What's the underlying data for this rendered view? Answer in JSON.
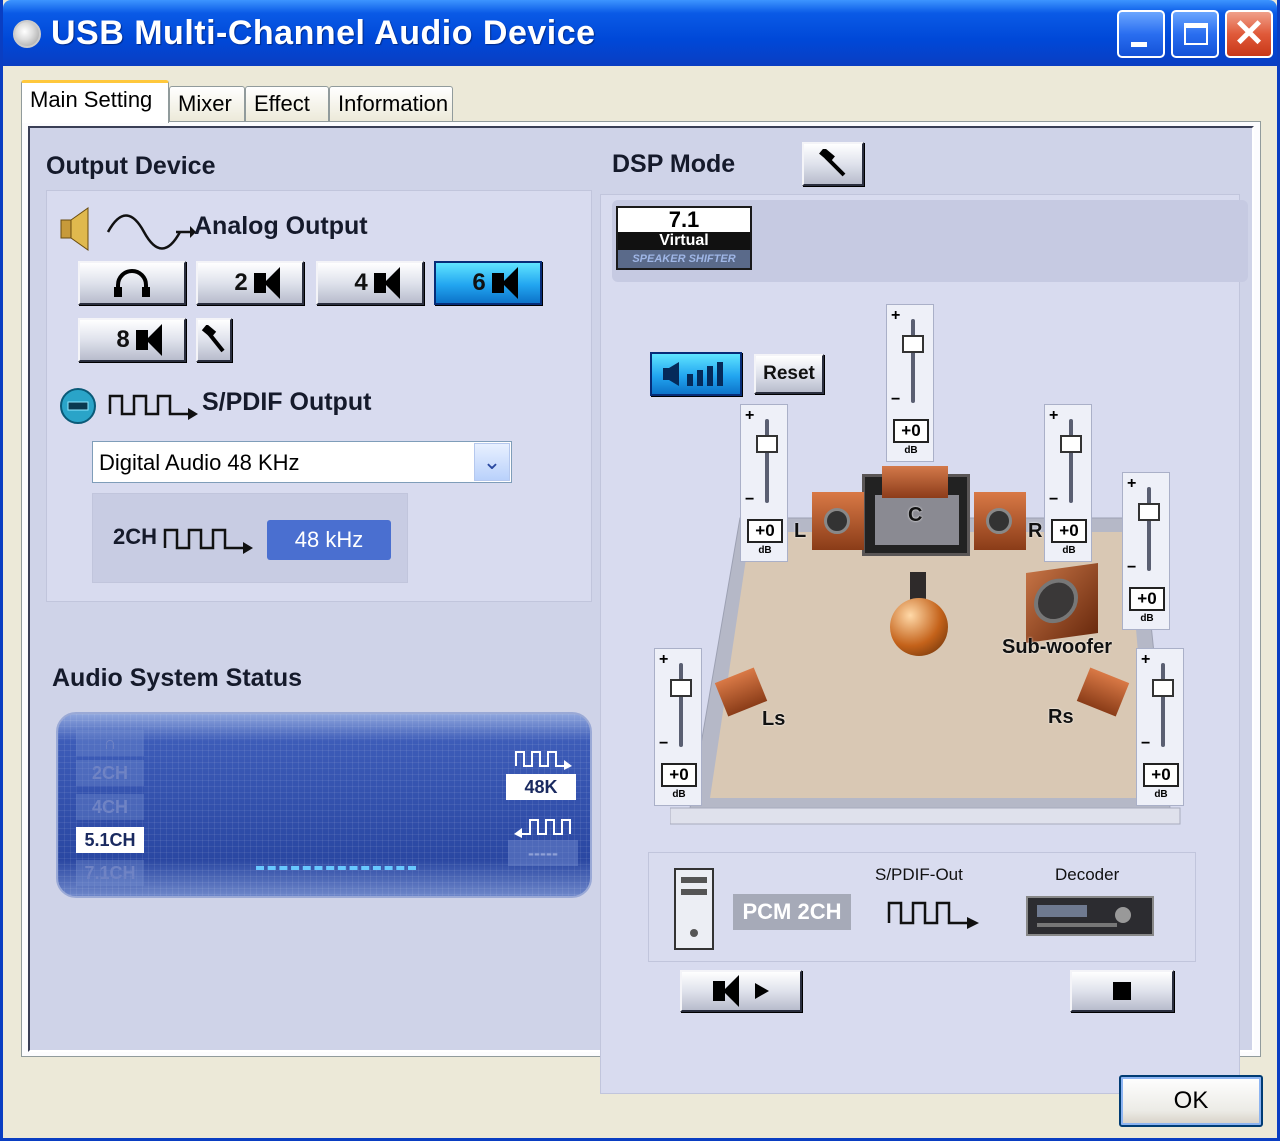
{
  "window": {
    "title": "USB Multi-Channel Audio Device"
  },
  "tabs": [
    {
      "label": "Main Setting",
      "active": true
    },
    {
      "label": "Mixer"
    },
    {
      "label": "Effect"
    },
    {
      "label": "Information"
    }
  ],
  "output_device": {
    "heading": "Output Device",
    "analog_label": "Analog Output",
    "speaker_buttons": [
      {
        "label": "",
        "icon": "headphone-icon"
      },
      {
        "label": "2",
        "icon": "speaker-icon"
      },
      {
        "label": "4",
        "icon": "speaker-icon"
      },
      {
        "label": "6",
        "icon": "speaker-icon",
        "active": true
      },
      {
        "label": "8",
        "icon": "speaker-icon"
      }
    ],
    "spdif_label": "S/PDIF Output",
    "spdif_select_value": "Digital Audio 48 KHz",
    "spdif_channels": "2CH",
    "spdif_rate": "48 kHz"
  },
  "audio_status": {
    "heading": "Audio System Status",
    "channel_items": [
      "2CH",
      "4CH",
      "5.1CH",
      "7.1CH"
    ],
    "active_channel": "5.1CH",
    "out_rate": "48K",
    "in_rate": "-----"
  },
  "dsp": {
    "heading": "DSP Mode",
    "virtual_logo_top": "7.1",
    "virtual_logo_mid": "Virtual",
    "virtual_logo_bottom": "SPEAKER SHIFTER",
    "reset_label": "Reset",
    "speakers": {
      "c": "C",
      "l": "L",
      "r": "R",
      "sub": "Sub-woofer",
      "ls": "Ls",
      "rs": "Rs"
    },
    "slider_plus": "+",
    "slider_minus": "−",
    "slider_value": "+0",
    "slider_unit": "dB",
    "pcm_label": "PCM 2CH",
    "spdif_out_label": "S/PDIF-Out",
    "decoder_label": "Decoder"
  },
  "footer": {
    "ok_label": "OK"
  },
  "colors": {
    "title_blue": "#0a5ae6",
    "active_cyan": "#22a5f0",
    "panel_lavender": "#cfd3e8",
    "rate_badge": "#4a6fd0"
  }
}
